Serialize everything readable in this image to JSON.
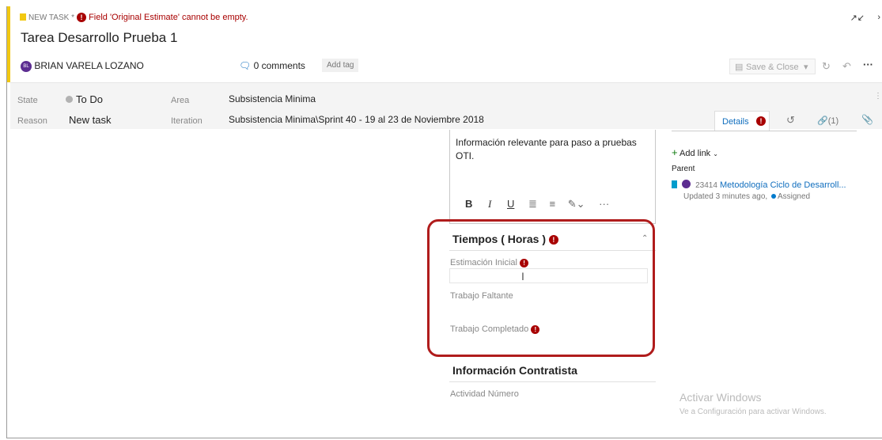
{
  "header": {
    "new_task_label": "NEW TASK",
    "error_message": "Field 'Original Estimate' cannot be empty.",
    "title": "Tarea Desarrollo Prueba 1",
    "assignee_initials": "BL",
    "assignee_name": "BRIAN VARELA LOZANO",
    "comments": "0 comments",
    "add_tag": "Add tag",
    "save_close": "Save & Close"
  },
  "fields": {
    "state_label": "State",
    "state_value": "To Do",
    "reason_label": "Reason",
    "reason_value": "New task",
    "area_label": "Area",
    "area_value": "Subsistencia Minima",
    "iteration_label": "Iteration",
    "iteration_value": "Subsistencia Minima\\Sprint 40 - 19 al 23 de Noviembre 2018"
  },
  "tabs": {
    "details": "Details",
    "links_count": "(1)"
  },
  "description": {
    "text": "Información relevante para paso a pruebas OTI."
  },
  "tiempos": {
    "title": "Tiempos ( Horas )",
    "estimacion_label": "Estimación Inicial",
    "estimacion_value": "",
    "trabajo_faltante_label": "Trabajo Faltante",
    "trabajo_completado_label": "Trabajo Completado"
  },
  "contratista": {
    "title": "Información Contratista",
    "actividad_label": "Actividad Número"
  },
  "related": {
    "add_link": "Add link",
    "parent_label": "Parent",
    "parent_id": "23414",
    "parent_title": "Metodología Ciclo de Desarroll...",
    "parent_updated": "Updated 3 minutes ago,",
    "parent_state": "Assigned"
  },
  "watermark": {
    "line1": "Activar Windows",
    "line2": "Ve a Configuración para activar Windows."
  },
  "colors": {
    "accent_yellow": "#f2c811",
    "error_red": "#a80000",
    "highlight_red": "#b01c1c",
    "link_blue": "#106ebe",
    "avatar_purple": "#5c2d91"
  }
}
